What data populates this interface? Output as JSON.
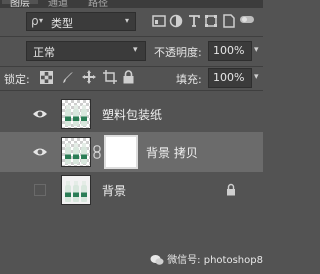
{
  "tabs": [
    "图层",
    "通道",
    "路径"
  ],
  "filter": {
    "kind_label": "类型",
    "search_prefix": "ρ"
  },
  "blend": {
    "mode": "正常",
    "opacity_label": "不透明度:",
    "opacity_value": "100%"
  },
  "lock": {
    "label": "锁定:",
    "fill_label": "填充:",
    "fill_value": "100%"
  },
  "layers": [
    {
      "name": "塑料包装纸",
      "visible": true,
      "selected": false
    },
    {
      "name": "背景 拷贝",
      "visible": true,
      "selected": true
    },
    {
      "name": "背景",
      "visible": false,
      "selected": false,
      "locked": true
    }
  ],
  "watermark": {
    "text": "微信号: photoshop8"
  }
}
